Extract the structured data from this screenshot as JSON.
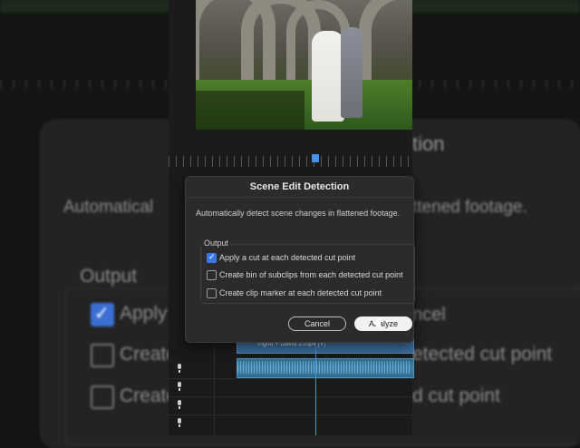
{
  "dialog": {
    "title": "Scene Edit Detection",
    "description": "Automatically detect scene changes in flattened footage.",
    "output_label": "Output",
    "options": [
      {
        "label": "Apply a cut at each detected cut point",
        "checked": true
      },
      {
        "label": "Create bin of subclips from each detected cut point",
        "checked": false
      },
      {
        "label": "Create clip marker at each detected cut point",
        "checked": false
      }
    ],
    "cancel_label": "Cancel",
    "analyze_label": "Analyze"
  },
  "background": {
    "title_fragment": "tion",
    "desc_left": "Automatical",
    "desc_right": "ttened footage.",
    "output_label": "Output",
    "opt1": "Apply",
    "opt2": "Create",
    "opt3": "Create",
    "opt2_right": "etected cut point",
    "opt3_right": "d cut point",
    "cancel_fragment": "ncel"
  },
  "timeline": {
    "clip_label": "Ingrid + David 2.mp4 [V]"
  },
  "colors": {
    "accent": "#3b78e7",
    "clip_video": "#3c6f9e",
    "clip_audio": "#3b85ad"
  }
}
